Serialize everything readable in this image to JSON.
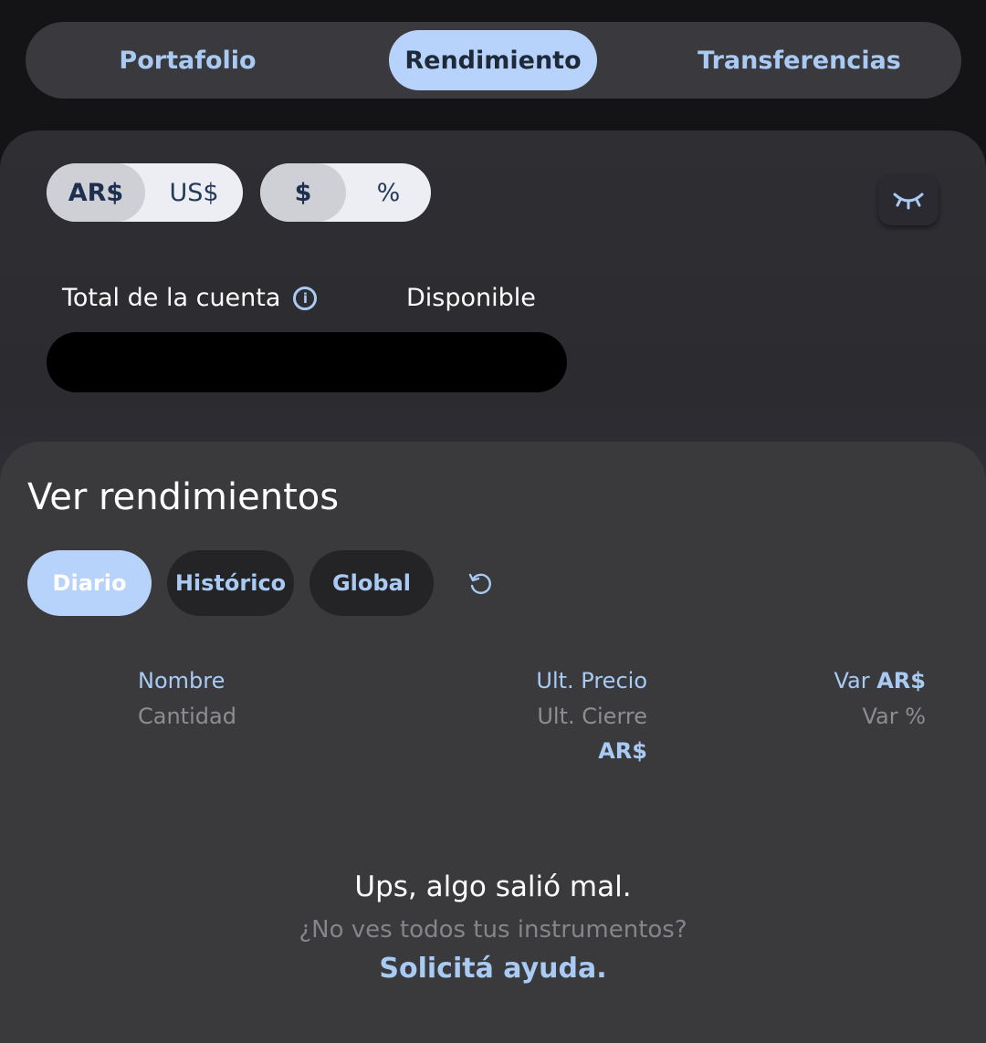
{
  "tabs": [
    {
      "label": "Portafolio",
      "active": false
    },
    {
      "label": "Rendimiento",
      "active": true
    },
    {
      "label": "Transferencias",
      "active": false
    }
  ],
  "account": {
    "currency_options": [
      "AR$",
      "US$"
    ],
    "currency_selected": "AR$",
    "unit_options": [
      "$",
      "%"
    ],
    "unit_selected": "$",
    "total_label": "Total de la cuenta",
    "available_label": "Disponible",
    "hide_icon": "eye-closed-icon",
    "info_icon": "info-icon"
  },
  "performance": {
    "title": "Ver rendimientos",
    "filters": [
      {
        "label": "Diario",
        "active": true
      },
      {
        "label": "Histórico",
        "active": false
      },
      {
        "label": "Global",
        "active": false
      }
    ],
    "refresh_icon": "refresh-icon",
    "columns": {
      "name": "Nombre",
      "quantity": "Cantidad",
      "last_price": "Ult. Precio",
      "last_close": "Ult. Cierre",
      "price_currency": "AR$",
      "var_label": "Var",
      "var_currency": "AR$",
      "var_percent": "Var %"
    },
    "error": {
      "title": "Ups, algo salió mal.",
      "subtitle": "¿No ves todos tus instrumentos?",
      "link": "Solicitá ayuda."
    }
  },
  "colors": {
    "accent": "#a9caf3",
    "active_pill": "#b7d3fb",
    "background": "#141416",
    "panel": "#3a3a3d"
  }
}
